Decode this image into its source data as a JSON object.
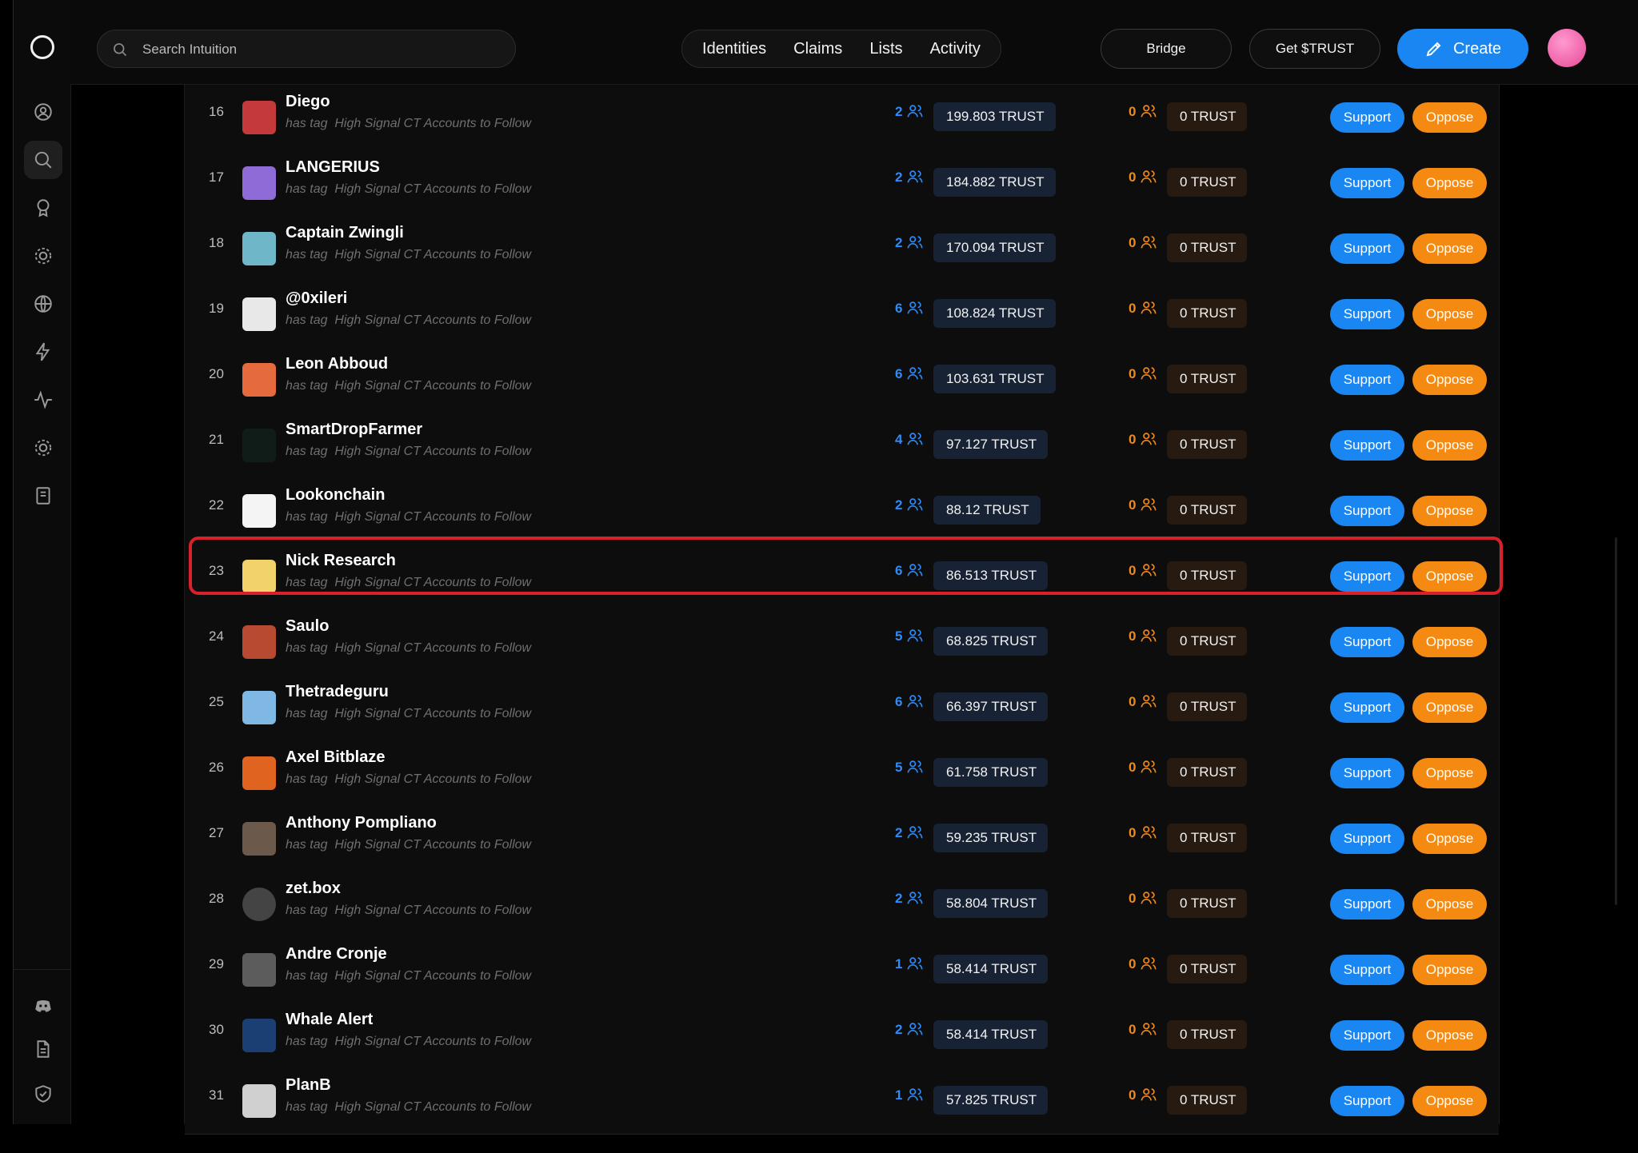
{
  "search": {
    "placeholder": "Search Intuition"
  },
  "nav": [
    "Identities",
    "Claims",
    "Lists",
    "Activity"
  ],
  "header": {
    "bridge": "Bridge",
    "get_trust": "Get $TRUST",
    "create": "Create"
  },
  "sidebar_icons": [
    "profile-icon",
    "search-icon",
    "badge-icon",
    "settings-gear-icon",
    "globe-icon",
    "lightning-icon",
    "activity-icon",
    "gear-icon",
    "book-icon",
    "discord-icon",
    "document-icon",
    "shield-check-icon"
  ],
  "labels": {
    "tag_prefix": "has tag",
    "tag_name": "High Signal CT Accounts to Follow",
    "support": "Support",
    "oppose": "Oppose"
  },
  "highlight_rank": "23",
  "rows": [
    {
      "rank": "16",
      "name": "Diego",
      "support_count": "2",
      "support_trust": "199.803 TRUST",
      "oppose_count": "0",
      "oppose_trust": "0 TRUST",
      "avatar_color": "#c43a3a"
    },
    {
      "rank": "17",
      "name": "LANGERIUS",
      "support_count": "2",
      "support_trust": "184.882 TRUST",
      "oppose_count": "0",
      "oppose_trust": "0 TRUST",
      "avatar_color": "#8e6bd6"
    },
    {
      "rank": "18",
      "name": "Captain Zwingli",
      "support_count": "2",
      "support_trust": "170.094 TRUST",
      "oppose_count": "0",
      "oppose_trust": "0 TRUST",
      "avatar_color": "#6fb6c9"
    },
    {
      "rank": "19",
      "name": "@0xileri",
      "support_count": "6",
      "support_trust": "108.824 TRUST",
      "oppose_count": "0",
      "oppose_trust": "0 TRUST",
      "avatar_color": "#e8e8e8"
    },
    {
      "rank": "20",
      "name": "Leon Abboud",
      "support_count": "6",
      "support_trust": "103.631 TRUST",
      "oppose_count": "0",
      "oppose_trust": "0 TRUST",
      "avatar_color": "#e56b3e"
    },
    {
      "rank": "21",
      "name": "SmartDropFarmer",
      "support_count": "4",
      "support_trust": "97.127 TRUST",
      "oppose_count": "0",
      "oppose_trust": "0 TRUST",
      "avatar_color": "#0f1c18"
    },
    {
      "rank": "22",
      "name": "Lookonchain",
      "support_count": "2",
      "support_trust": "88.12 TRUST",
      "oppose_count": "0",
      "oppose_trust": "0 TRUST",
      "avatar_color": "#f4f4f4"
    },
    {
      "rank": "23",
      "name": "Nick Research",
      "support_count": "6",
      "support_trust": "86.513 TRUST",
      "oppose_count": "0",
      "oppose_trust": "0 TRUST",
      "avatar_color": "#f2d36b"
    },
    {
      "rank": "24",
      "name": "Saulo",
      "support_count": "5",
      "support_trust": "68.825 TRUST",
      "oppose_count": "0",
      "oppose_trust": "0 TRUST",
      "avatar_color": "#b84a32"
    },
    {
      "rank": "25",
      "name": "Thetradeguru",
      "support_count": "6",
      "support_trust": "66.397 TRUST",
      "oppose_count": "0",
      "oppose_trust": "0 TRUST",
      "avatar_color": "#7fb9e3"
    },
    {
      "rank": "26",
      "name": "Axel Bitblaze",
      "support_count": "5",
      "support_trust": "61.758 TRUST",
      "oppose_count": "0",
      "oppose_trust": "0 TRUST",
      "avatar_color": "#e0641f"
    },
    {
      "rank": "27",
      "name": "Anthony Pompliano",
      "support_count": "2",
      "support_trust": "59.235 TRUST",
      "oppose_count": "0",
      "oppose_trust": "0 TRUST",
      "avatar_color": "#6b5a4c"
    },
    {
      "rank": "28",
      "name": "zet.box",
      "support_count": "2",
      "support_trust": "58.804 TRUST",
      "oppose_count": "0",
      "oppose_trust": "0 TRUST",
      "avatar_color": "#444444"
    },
    {
      "rank": "29",
      "name": "Andre Cronje",
      "support_count": "1",
      "support_trust": "58.414 TRUST",
      "oppose_count": "0",
      "oppose_trust": "0 TRUST",
      "avatar_color": "#5c5c5c"
    },
    {
      "rank": "30",
      "name": "Whale Alert",
      "support_count": "2",
      "support_trust": "58.414 TRUST",
      "oppose_count": "0",
      "oppose_trust": "0 TRUST",
      "avatar_color": "#1b3f73"
    },
    {
      "rank": "31",
      "name": "PlanB",
      "support_count": "1",
      "support_trust": "57.825 TRUST",
      "oppose_count": "0",
      "oppose_trust": "0 TRUST",
      "avatar_color": "#d0d0d0"
    }
  ]
}
